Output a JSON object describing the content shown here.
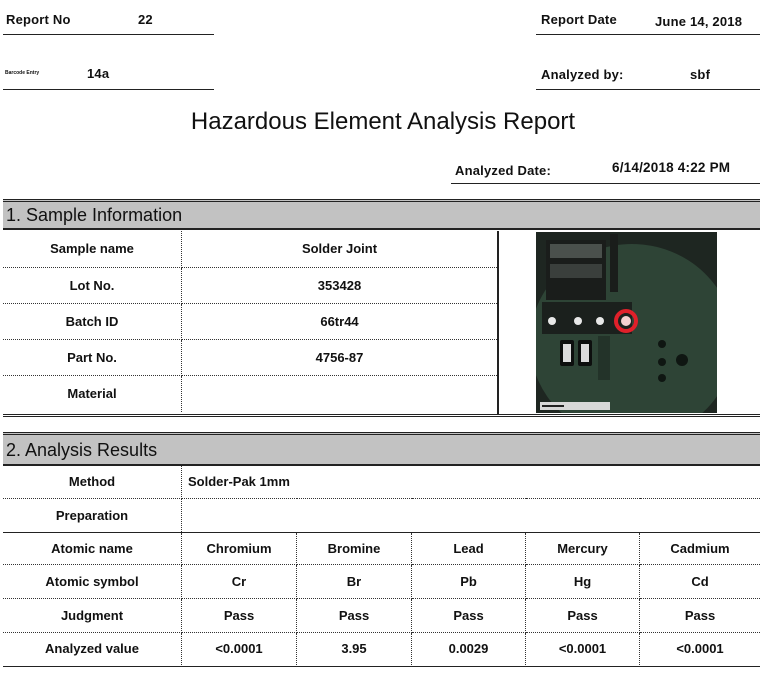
{
  "header": {
    "report_no_label": "Report No",
    "report_no": "22",
    "report_date_label": "Report Date",
    "report_date": "June 14, 2018",
    "small_label": "Barcode Entry",
    "small_value": "14a",
    "analyzed_by_label": "Analyzed by:",
    "analyzed_by": "sbf",
    "title": "Hazardous Element Analysis Report",
    "analyzed_date_label": "Analyzed Date:",
    "analyzed_date": "6/14/2018 4:22 PM"
  },
  "sample": {
    "heading": "1. Sample Information",
    "rows": [
      {
        "label": "Sample name",
        "value": "Solder Joint"
      },
      {
        "label": "Lot No.",
        "value": "353428"
      },
      {
        "label": "Batch ID",
        "value": "66tr44"
      },
      {
        "label": "Part No.",
        "value": "4756-87"
      },
      {
        "label": "Material",
        "value": ""
      }
    ]
  },
  "results": {
    "heading": "2. Analysis Results",
    "method_label": "Method",
    "method_value": "Solder-Pak 1mm",
    "preparation_label": "Preparation",
    "preparation_value": "",
    "atomic_name_label": "Atomic name",
    "atomic_symbol_label": "Atomic symbol",
    "judgment_label": "Judgment",
    "analyzed_value_label": "Analyzed value",
    "elements": [
      {
        "name": "Chromium",
        "symbol": "Cr",
        "judgment": "Pass",
        "value": "<0.0001"
      },
      {
        "name": "Bromine",
        "symbol": "Br",
        "judgment": "Pass",
        "value": "3.95"
      },
      {
        "name": "Lead",
        "symbol": "Pb",
        "judgment": "Pass",
        "value": "0.0029"
      },
      {
        "name": "Mercury",
        "symbol": "Hg",
        "judgment": "Pass",
        "value": "<0.0001"
      },
      {
        "name": "Cadmium",
        "symbol": "Cd",
        "judgment": "Pass",
        "value": "<0.0001"
      }
    ]
  },
  "colors": {
    "section_bg": "#c2c2c2",
    "marker": "#e0202a"
  }
}
